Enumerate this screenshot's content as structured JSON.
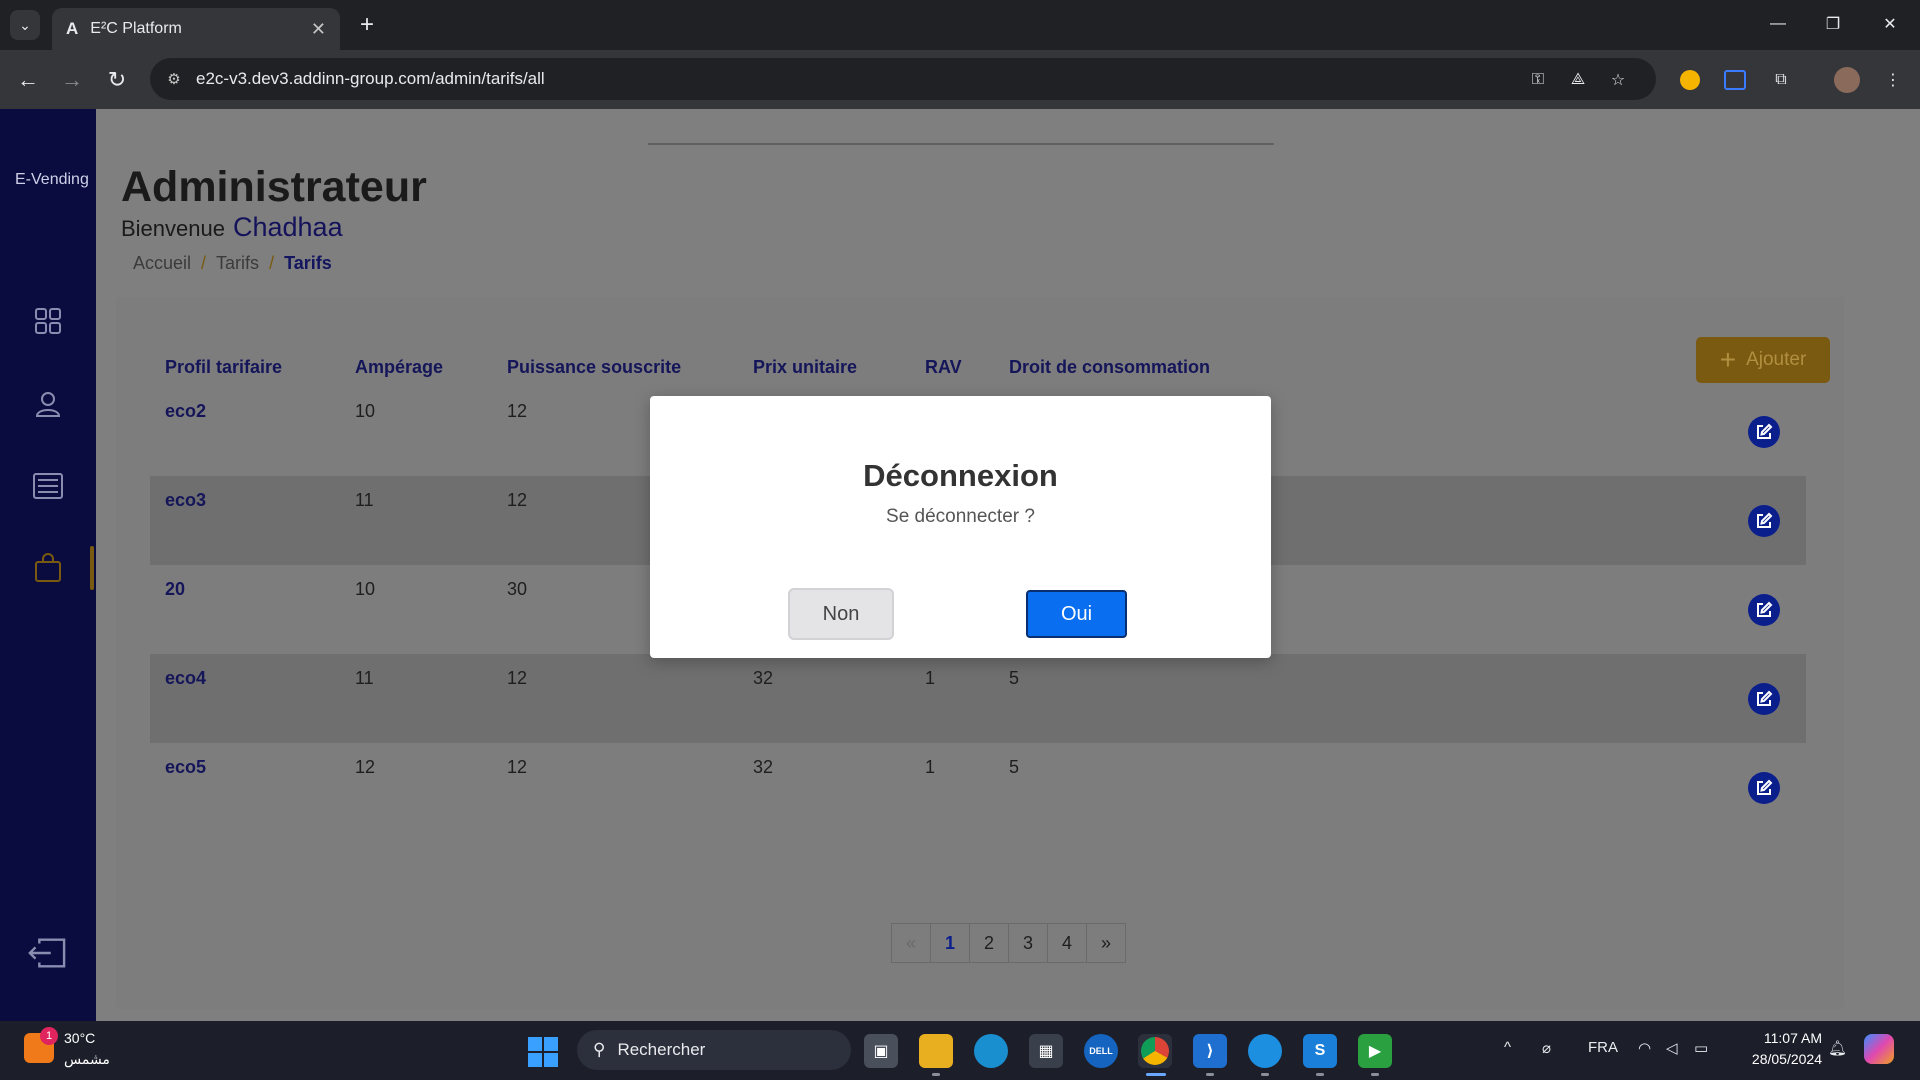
{
  "browser": {
    "tab_title": "E²C Platform",
    "tab_favicon": "A",
    "url": "e2c-v3.dev3.addinn-group.com/admin/tarifs/all"
  },
  "sidebar": {
    "brand": "E-Vending",
    "items": [
      {
        "icon": "dashboard-grid-icon"
      },
      {
        "icon": "user-icon"
      },
      {
        "icon": "list-icon"
      },
      {
        "icon": "shopping-bag-icon"
      }
    ],
    "logout_icon": "logout-icon"
  },
  "header": {
    "title": "Administrateur",
    "welcome": "Bienvenue",
    "username": "Chadhaa"
  },
  "breadcrumb": {
    "home": "Accueil",
    "sep": "/",
    "parent": "Tarifs",
    "current": "Tarifs"
  },
  "table": {
    "add_label": "Ajouter",
    "columns": [
      "Profil tarifaire",
      "Ampérage",
      "Puissance souscrite",
      "Prix unitaire",
      "RAV",
      "Droit de consommation"
    ],
    "rows": [
      {
        "profil": "eco2",
        "amperage": "10",
        "puissance": "12",
        "prix": "",
        "rav": "",
        "droit": ""
      },
      {
        "profil": "eco3",
        "amperage": "11",
        "puissance": "12",
        "prix": "",
        "rav": "",
        "droit": ""
      },
      {
        "profil": "20",
        "amperage": "10",
        "puissance": "30",
        "prix": "",
        "rav": "",
        "droit": ""
      },
      {
        "profil": "eco4",
        "amperage": "11",
        "puissance": "12",
        "prix": "32",
        "rav": "1",
        "droit": "5"
      },
      {
        "profil": "eco5",
        "amperage": "12",
        "puissance": "12",
        "prix": "32",
        "rav": "1",
        "droit": "5"
      }
    ]
  },
  "pagination": {
    "prev": "«",
    "pages": [
      "1",
      "2",
      "3",
      "4"
    ],
    "current": "1",
    "next": "»"
  },
  "modal": {
    "title": "Déconnexion",
    "text": "Se déconnecter ?",
    "cancel": "Non",
    "confirm": "Oui"
  },
  "taskbar": {
    "weather_temp": "30°C",
    "weather_desc": "مشمس",
    "weather_badge": "1",
    "search_placeholder": "Rechercher",
    "lang": "FRA",
    "time": "11:07 AM",
    "date": "28/05/2024"
  },
  "colors": {
    "sidebar": "#0a0c3f",
    "accent_gold": "#7a5a10",
    "primary_blue": "#0a6ef0",
    "title_navy": "#13155f"
  }
}
